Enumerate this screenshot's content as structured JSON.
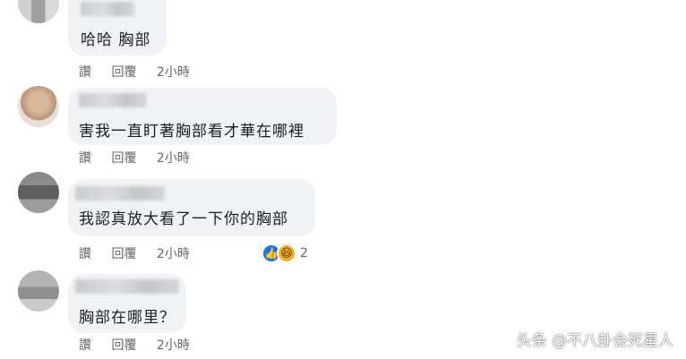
{
  "comments": [
    {
      "text": "哈哈 胸部",
      "actions": {
        "like": "讚",
        "reply": "回覆",
        "time": "2小時"
      }
    },
    {
      "text": "害我一直盯著胸部看才華在哪裡",
      "actions": {
        "like": "讚",
        "reply": "回覆",
        "time": "2小時"
      }
    },
    {
      "text": "我認真放大看了一下你的胸部",
      "actions": {
        "like": "讚",
        "reply": "回覆",
        "time": "2小時"
      },
      "reactions": {
        "icons": [
          "like-icon",
          "haha-icon"
        ],
        "count": "2"
      }
    },
    {
      "text": "胸部在哪里？",
      "actions": {
        "like": "讚",
        "reply": "回覆",
        "time": "2小時"
      }
    }
  ],
  "watermark": "头条 @不八卦会死星人",
  "colors": {
    "bubble": "#f0f2f5",
    "text": "#1c1e21",
    "action_text": "#65676b",
    "like_blue": "#1877f2",
    "haha_yellow": "#f7b125"
  }
}
